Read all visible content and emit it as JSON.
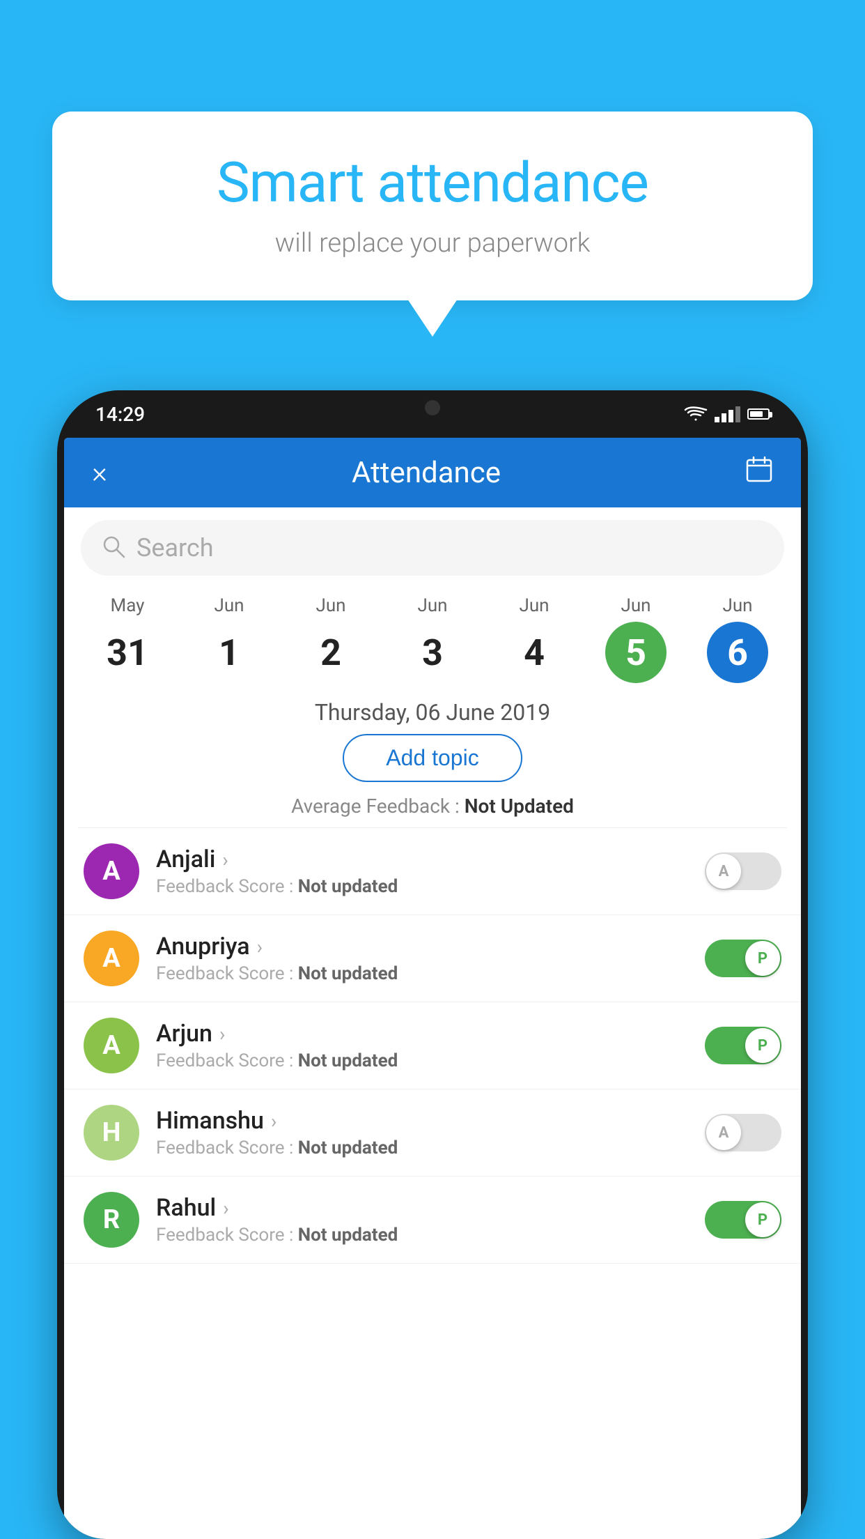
{
  "bubble": {
    "title": "Smart attendance",
    "subtitle": "will replace your paperwork"
  },
  "statusBar": {
    "time": "14:29"
  },
  "appHeader": {
    "title": "Attendance",
    "closeLabel": "×",
    "calendarLabel": "📅"
  },
  "search": {
    "placeholder": "Search"
  },
  "calendar": {
    "days": [
      {
        "month": "May",
        "date": "31",
        "state": "normal"
      },
      {
        "month": "Jun",
        "date": "1",
        "state": "normal"
      },
      {
        "month": "Jun",
        "date": "2",
        "state": "normal"
      },
      {
        "month": "Jun",
        "date": "3",
        "state": "normal"
      },
      {
        "month": "Jun",
        "date": "4",
        "state": "normal"
      },
      {
        "month": "Jun",
        "date": "5",
        "state": "today"
      },
      {
        "month": "Jun",
        "date": "6",
        "state": "selected"
      }
    ]
  },
  "selectedDate": "Thursday, 06 June 2019",
  "addTopicLabel": "Add topic",
  "avgFeedback": {
    "label": "Average Feedback : ",
    "value": "Not Updated"
  },
  "students": [
    {
      "name": "Anjali",
      "initials": "A",
      "avatarColor": "#9c27b0",
      "feedback": "Feedback Score : ",
      "feedbackValue": "Not updated",
      "toggleState": "off",
      "toggleLabel": "A"
    },
    {
      "name": "Anupriya",
      "initials": "A",
      "avatarColor": "#f9a825",
      "feedback": "Feedback Score : ",
      "feedbackValue": "Not updated",
      "toggleState": "on",
      "toggleLabel": "P"
    },
    {
      "name": "Arjun",
      "initials": "A",
      "avatarColor": "#8bc34a",
      "feedback": "Feedback Score : ",
      "feedbackValue": "Not updated",
      "toggleState": "on",
      "toggleLabel": "P"
    },
    {
      "name": "Himanshu",
      "initials": "H",
      "avatarColor": "#aed581",
      "feedback": "Feedback Score : ",
      "feedbackValue": "Not updated",
      "toggleState": "off",
      "toggleLabel": "A"
    },
    {
      "name": "Rahul",
      "initials": "R",
      "avatarColor": "#4caf50",
      "feedback": "Feedback Score : ",
      "feedbackValue": "Not updated",
      "toggleState": "on",
      "toggleLabel": "P"
    }
  ]
}
